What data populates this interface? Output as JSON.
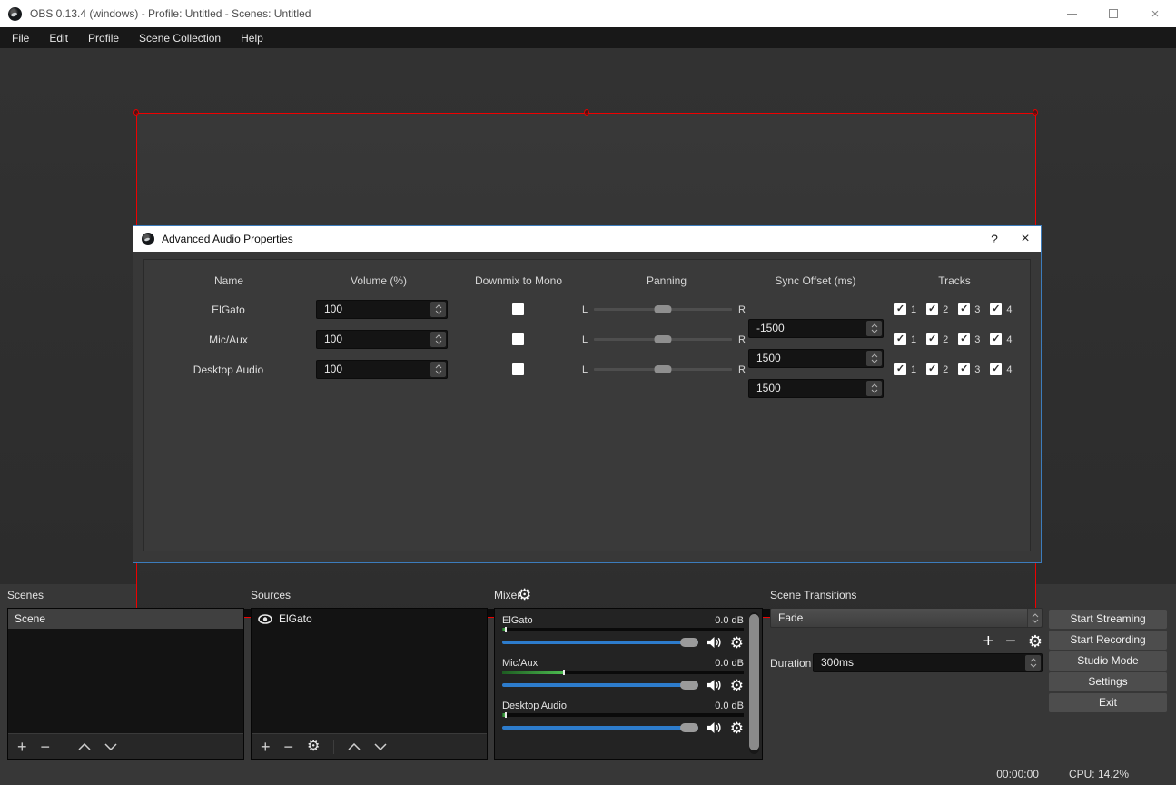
{
  "window": {
    "title": "OBS 0.13.4 (windows) - Profile: Untitled - Scenes: Untitled"
  },
  "menu": {
    "items": [
      "File",
      "Edit",
      "Profile",
      "Scene Collection",
      "Help"
    ]
  },
  "icons": {
    "gear": "⚙",
    "check": "✓",
    "plus": "+",
    "minus": "−",
    "help": "?",
    "close": "×"
  },
  "dialog": {
    "title": "Advanced Audio Properties",
    "columns": [
      "Name",
      "Volume (%)",
      "Downmix to Mono",
      "Panning",
      "Sync Offset (ms)",
      "Tracks"
    ],
    "pan_left": "L",
    "pan_right": "R",
    "track_labels": [
      "1",
      "2",
      "3",
      "4"
    ],
    "rows": [
      {
        "name": "ElGato",
        "volume": "100",
        "downmix": false,
        "sync_offset": "-1500",
        "tracks_enabled": [
          true,
          true,
          true,
          true
        ]
      },
      {
        "name": "Mic/Aux",
        "volume": "100",
        "downmix": false,
        "sync_offset": "1500",
        "tracks_enabled": [
          true,
          true,
          true,
          true
        ]
      },
      {
        "name": "Desktop Audio",
        "volume": "100",
        "downmix": false,
        "sync_offset": "1500",
        "tracks_enabled": [
          true,
          true,
          true,
          true
        ]
      }
    ]
  },
  "scenes": {
    "title": "Scenes",
    "items": [
      "Scene"
    ]
  },
  "sources": {
    "title": "Sources",
    "items": [
      "ElGato"
    ]
  },
  "mixer": {
    "title": "Mixer",
    "channels": [
      {
        "name": "ElGato",
        "db": "0.0 dB",
        "meter_pct": 1,
        "fader_pct": 100
      },
      {
        "name": "Mic/Aux",
        "db": "0.0 dB",
        "meter_pct": 25,
        "fader_pct": 100
      },
      {
        "name": "Desktop Audio",
        "db": "0.0 dB",
        "meter_pct": 1,
        "fader_pct": 100
      }
    ]
  },
  "transitions": {
    "title": "Scene Transitions",
    "selected": "Fade",
    "duration_label": "Duration",
    "duration_value": "300ms"
  },
  "controls": {
    "buttons": [
      "Start Streaming",
      "Start Recording",
      "Studio Mode",
      "Settings",
      "Exit"
    ]
  },
  "status": {
    "time": "00:00:00",
    "cpu": "CPU: 14.2%"
  },
  "colors": {
    "accent_blue": "#2d7ccc",
    "selection_red": "#ee0000",
    "meter_green": "#4cbb4f",
    "dialog_border": "#3c7cbc"
  }
}
